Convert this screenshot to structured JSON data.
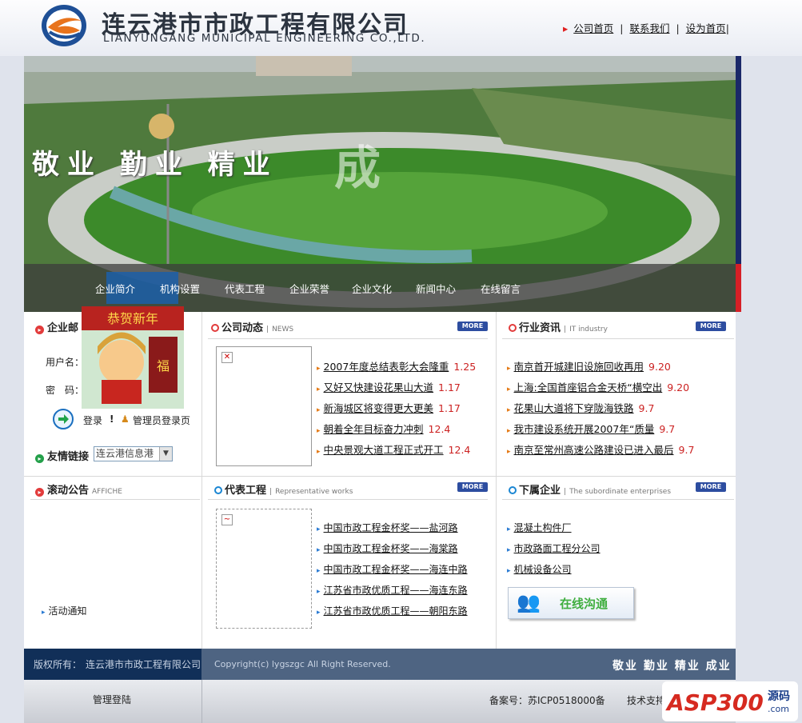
{
  "header": {
    "company_cn": "连云港市市政工程有限公司",
    "company_en": "LIANYUNGANG MUNICIPAL ENGINEERING CO.,LTD.",
    "links": [
      "公司首页",
      "联系我们",
      "设为首页"
    ]
  },
  "banner": {
    "slogan": "敬业 勤业 精业",
    "slogan_extra": "成"
  },
  "nav": [
    "企业简介",
    "机构设置",
    "代表工程",
    "企业荣誉",
    "企业文化",
    "新闻中心",
    "在线留言"
  ],
  "login": {
    "title": "企业邮",
    "username_label": "用户名：",
    "password_label": "密　码：",
    "login_link": "登录",
    "admin_link": "管理员登录页",
    "new_year_text": "恭贺新年"
  },
  "links_box": {
    "label": "友情链接",
    "select_value": "连云港信息港"
  },
  "affiche": {
    "title": "滚动公告",
    "subtitle": "AFFICHE",
    "item": "活动通知"
  },
  "news": {
    "title": "公司动态",
    "subtitle": "NEWS",
    "more": "MORE",
    "items": [
      {
        "t": "2007年度总结表彰大会隆重",
        "d": "1.25"
      },
      {
        "t": "又好又快建设花果山大道",
        "d": "1.17"
      },
      {
        "t": "新海城区将变得更大更美",
        "d": "1.17"
      },
      {
        "t": "朝着全年目标奋力冲刺",
        "d": "12.4"
      },
      {
        "t": "中央景观大道工程正式开工",
        "d": "12.4"
      }
    ]
  },
  "industry": {
    "title": "行业资讯",
    "subtitle": "IT industry",
    "more": "MORE",
    "items": [
      {
        "t": "南京首开城建旧设施回收再用",
        "d": "9.20"
      },
      {
        "t": "上海:全国首座铝合金天桥“横空出",
        "d": "9.20"
      },
      {
        "t": "花果山大道将下穿陇海铁路",
        "d": "9.7"
      },
      {
        "t": "我市建设系统开展2007年“质量",
        "d": "9.7"
      },
      {
        "t": "南京至常州高速公路建设已进入最后",
        "d": "9.7"
      }
    ]
  },
  "works": {
    "title": "代表工程",
    "subtitle": "Representative works",
    "more": "MORE",
    "items": [
      "中国市政工程金杯奖——盐河路",
      "中国市政工程金杯奖——海棠路",
      "中国市政工程金杯奖——海连中路",
      "江苏省市政优质工程——海连东路",
      "江苏省市政优质工程——朝阳东路"
    ]
  },
  "sub": {
    "title": "下属企业",
    "subtitle": "The subordinate enterprises",
    "more": "MORE",
    "items": [
      "混凝土构件厂",
      "市政路面工程分公司",
      "机械设备公司"
    ],
    "online": "在线沟通"
  },
  "footer": {
    "copyright_label": "版权所有：",
    "copyright_owner": "连云港市市政工程有限公司",
    "copyright_en": "Copyright(c) lygszgc All Right Reserved.",
    "motto": "敬业 勤业 精业 成业",
    "admin_login": "管理登陆",
    "icp": "备案号：苏ICP0518000备",
    "tech": "技术支持",
    "watermark": "ASP300",
    "watermark_cn": "源码",
    "watermark_com": ".com"
  },
  "colors": {
    "accent": "#1c5fa8",
    "footer_dark": "#112f58",
    "date_red": "#c22"
  }
}
